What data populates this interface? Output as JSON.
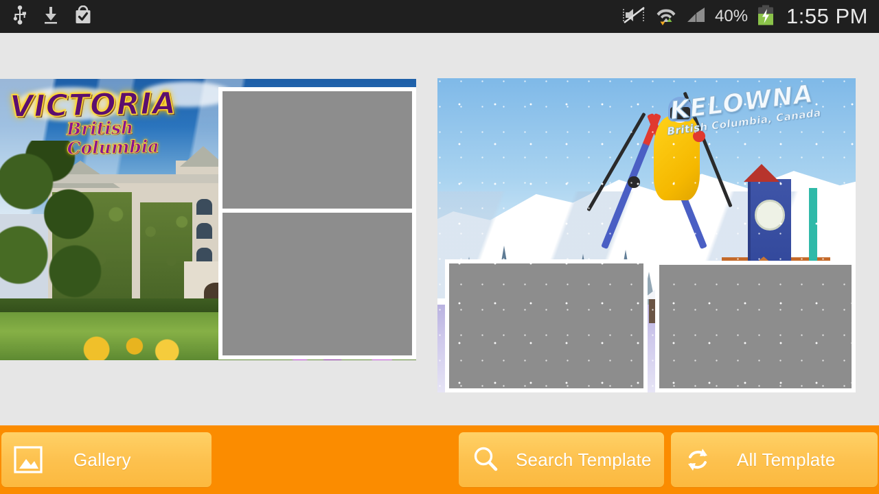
{
  "status_bar": {
    "left_icons": [
      {
        "name": "usb-icon",
        "label": "USB"
      },
      {
        "name": "download-icon",
        "label": "Download"
      },
      {
        "name": "app-install-complete-icon",
        "label": "Install complete"
      }
    ],
    "right_icons": [
      {
        "name": "sound-muted-vibrate-icon",
        "label": "Sound off / vibrate"
      },
      {
        "name": "wifi-data-transfer-icon",
        "label": "Wi-Fi with data transfer"
      },
      {
        "name": "cellular-signal-icon",
        "label": "Cellular signal"
      },
      {
        "name": "battery-charging-icon",
        "label": "Battery charging"
      }
    ],
    "battery_percent": "40%",
    "clock": "1:55 PM",
    "background_color": "#1f1f1f",
    "text_color": "#e0e0e0",
    "battery_fill_color": "#8bc34a"
  },
  "page": {
    "background_color": "#e6e6e6"
  },
  "templates": [
    {
      "id": "victoria",
      "name": "Victoria British Columbia postcard template",
      "title": "VICTORIA",
      "subtitle": "British Columbia",
      "title_color": "#5c0f6e",
      "title_glow_color": "#ffd21a",
      "photo_slots": 2,
      "slot_color": "#8d8d8d",
      "slot_border_color": "#ffffff"
    },
    {
      "id": "kelowna",
      "name": "Kelowna British Columbia Canada ski postcard template",
      "title": "KELOWNA",
      "subtitle": "British Columbia, Canada",
      "title_color": "#f4f9fd",
      "title_glow_color": "#8fb8d8",
      "photo_slots": 2,
      "slot_color": "#8d8d8d",
      "slot_border_color": "#ffffff"
    }
  ],
  "toolbar": {
    "background_color": "#fb8c00",
    "button_color": "#fdc14e",
    "buttons": [
      {
        "id": "gallery",
        "label": "Gallery",
        "icon": "image-icon"
      },
      {
        "id": "search-template",
        "label": "Search Template",
        "icon": "search-icon"
      },
      {
        "id": "all-template",
        "label": "All Template",
        "icon": "refresh-icon"
      }
    ]
  }
}
